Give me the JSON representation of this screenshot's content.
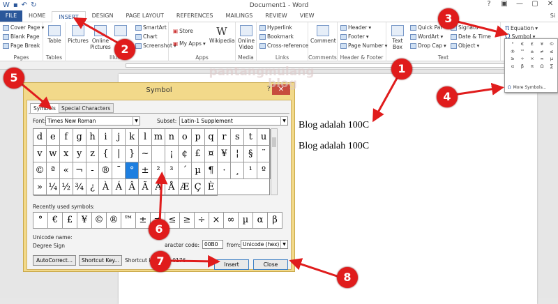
{
  "window": {
    "title": "Document1 - Word",
    "user_clip": "Si",
    "controls": [
      "?",
      "▣",
      "—",
      "▢",
      "✕"
    ],
    "qat_icons": [
      "word-icon",
      "save-icon",
      "undo-icon",
      "redo-icon"
    ]
  },
  "tabs": [
    "FILE",
    "HOME",
    "INSERT",
    "DESIGN",
    "PAGE LAYOUT",
    "REFERENCES",
    "MAILINGS",
    "REVIEW",
    "VIEW"
  ],
  "active_tab": "INSERT",
  "ribbon": {
    "pages": {
      "label": "Pages",
      "items": [
        "Cover Page",
        "Blank Page",
        "Page Break"
      ]
    },
    "tables": {
      "label": "Tables",
      "table": "Table"
    },
    "illustrations": {
      "label": "Illustrations",
      "label_visible": "Illustr",
      "pictures": "Pictures",
      "online_pictures": "Online Pictures",
      "smartart": "SmartArt",
      "chart": "Chart",
      "screenshot": "Screenshot"
    },
    "apps": {
      "label": "Apps",
      "store": "Store",
      "my_apps": "My Apps",
      "wikipedia": "Wikipedia"
    },
    "media": {
      "label": "Media",
      "online_video": "Online Video"
    },
    "links": {
      "label": "Links",
      "hyperlink": "Hyperlink",
      "bookmark": "Bookmark",
      "cross_reference": "Cross-reference"
    },
    "comments": {
      "label": "Comments",
      "comment": "Comment"
    },
    "header_footer": {
      "label": "Header & Footer",
      "header": "Header",
      "footer": "Footer",
      "page_number": "Page Number"
    },
    "text": {
      "label": "Text",
      "text_box": "Text Box",
      "quick_parts": "Quick Par",
      "wordart": "WordArt",
      "drop_cap": "Drop Cap",
      "signature": "Signatu",
      "date_time": "Date & Time",
      "object": "Object"
    },
    "symbols": {
      "equation": "Equation",
      "symbol": "Symbol"
    }
  },
  "symbol_dropdown": {
    "symbols": [
      "°",
      "€",
      "£",
      "¥",
      "©",
      "®",
      "™",
      "±",
      "≠",
      "≤",
      "≥",
      "÷",
      "×",
      "∞",
      "µ",
      "α",
      "β",
      "π",
      "Ω",
      "∑"
    ],
    "more_label": "More Symbols..."
  },
  "document": {
    "lines": [
      "Blog adalah 100C",
      "Blog adalah 100C"
    ]
  },
  "watermark": {
    "line1": "pantangmulang",
    "line2": "blog"
  },
  "dialog": {
    "title": "Symbol",
    "help": "?",
    "close_x": "✕",
    "tabs": [
      "Symbols",
      "Special Characters"
    ],
    "font_label": "Font:",
    "font_value": "Times New Roman",
    "subset_label": "Subset:",
    "subset_value": "Latin-1 Supplement",
    "grid": [
      "d",
      "e",
      "f",
      "g",
      "h",
      "i",
      "j",
      "k",
      "l",
      "m",
      "n",
      "o",
      "p",
      "q",
      "r",
      "s",
      "t",
      "u",
      "v",
      "w",
      "x",
      "y",
      "z",
      "{",
      "|",
      "}",
      "~",
      "",
      "¡",
      "¢",
      "£",
      "¤",
      "¥",
      "¦",
      "§",
      "¨",
      "©",
      "ª",
      "«",
      "¬",
      "-",
      "®",
      "¯",
      "°",
      "±",
      "²",
      "³",
      "´",
      "µ",
      "¶",
      "·",
      "¸",
      "¹",
      "º",
      "»",
      "¼",
      "½",
      "¾",
      "¿",
      "À",
      "Á",
      "Â",
      "Ã",
      "Ä",
      "Å",
      "Æ",
      "Ç",
      "È"
    ],
    "selected_symbol": "°",
    "recent_label": "Recently used symbols:",
    "recent": [
      "°",
      "€",
      "£",
      "¥",
      "©",
      "®",
      "™",
      "±",
      "≠",
      "≤",
      "≥",
      "÷",
      "×",
      "∞",
      "µ",
      "α",
      "β"
    ],
    "unicode_name_label": "Unicode name:",
    "unicode_name": "Degree Sign",
    "char_code_label": "Character code:",
    "char_code_label_visible": "aracter code:",
    "char_code": "00B0",
    "from_label": "from:",
    "from_value": "Unicode (hex)",
    "autocorrect": "AutoCorrect...",
    "shortcut_key_button": "Shortcut Key...",
    "shortcut_key_text": "Shortcut key: Alt+0176",
    "insert": "Insert",
    "close": "Close"
  },
  "callouts": [
    "1",
    "2",
    "3",
    "4",
    "5",
    "6",
    "7",
    "8"
  ],
  "colors": {
    "accent": "#2b579a",
    "callout": "#e01c1c",
    "dialog_frame": "#f2d98a",
    "selection": "#1e7fe0"
  }
}
